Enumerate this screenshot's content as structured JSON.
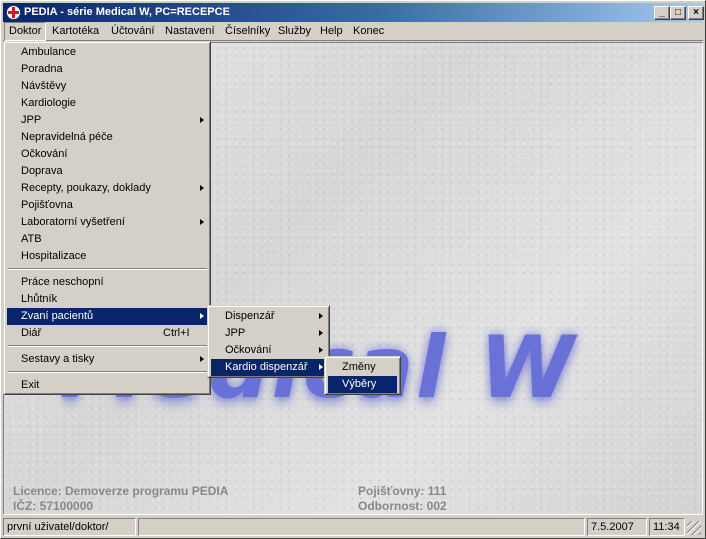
{
  "window": {
    "title": "PEDIA - série Medical W,  PC=RECEPCE",
    "minimize_glyph": "_",
    "maximize_glyph": "□",
    "close_glyph": "×"
  },
  "menubar": [
    "Doktor",
    "Kartotéka",
    "Účtování",
    "Nastavení",
    "Číselníky",
    "Služby",
    "Help",
    "Konec"
  ],
  "doktor_menu": {
    "items": [
      "Ambulance",
      "Poradna",
      "Návštěvy",
      "Kardiologie",
      "JPP",
      "Nepravidelná péče",
      "Očkování",
      "Doprava",
      "Recepty, poukazy, doklady",
      "Pojišťovna",
      "Laboratorní vyšetření",
      "ATB",
      "Hospitalizace",
      "Práce neschopní",
      "Lhůtník",
      "Zvaní pacientů",
      "Diář",
      "Sestavy a tisky",
      "Exit"
    ],
    "diar_shortcut": "Ctrl+I"
  },
  "zvani_menu": {
    "items": [
      "Dispenzář",
      "JPP",
      "Očkování",
      "Kardio dispenzář"
    ]
  },
  "kardio_menu": {
    "items": [
      "Změny",
      "Výběry"
    ]
  },
  "background": {
    "logo_text": "Medical W",
    "licence": "Licence: Demoverze programu PEDIA",
    "icz": "IČZ: 57100000",
    "pojistovny": "Pojišťovny: 111",
    "odbornost": "Odbornost: 002"
  },
  "status": {
    "user": "první uživatel/doktor/",
    "message": "",
    "date": "7.5.2007",
    "time": "11:34"
  },
  "colors": {
    "highlight": "#0a246a",
    "face": "#d4d0c8",
    "logo": "#5e66d6"
  }
}
